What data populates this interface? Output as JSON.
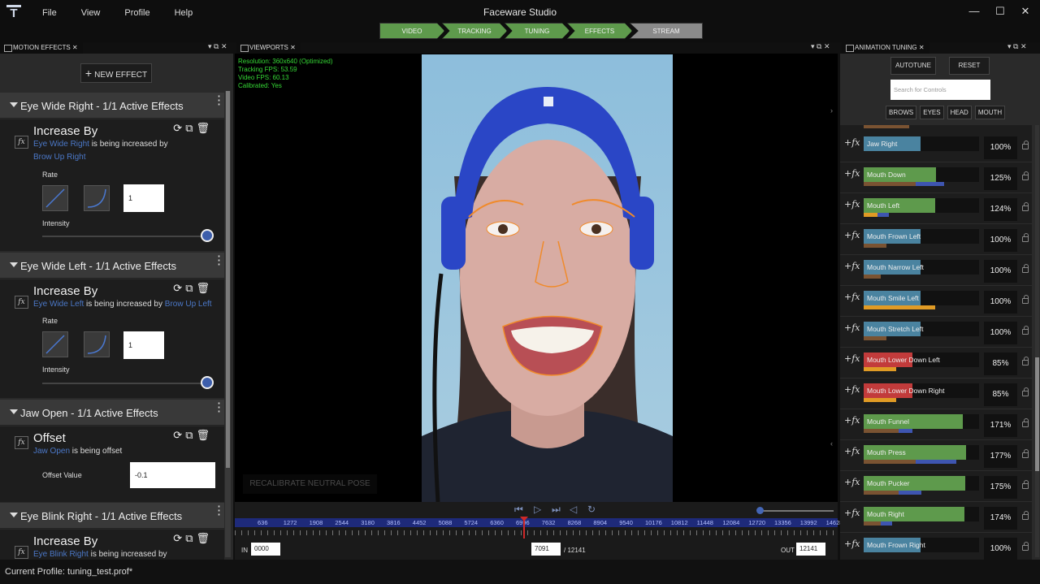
{
  "app": {
    "title": "Faceware Studio",
    "logo": "T",
    "menu": [
      "File",
      "View",
      "Profile",
      "Help"
    ],
    "window_controls": {
      "minimize": "—",
      "maximize": "☐",
      "close": "✕"
    }
  },
  "workflow": [
    "VIDEO",
    "TRACKING",
    "TUNING",
    "EFFECTS",
    "STREAM"
  ],
  "panels": {
    "motion_effects": "MOTION EFFECTS",
    "viewports": "VIEWPORTS",
    "animation_tuning": "ANIMATION TUNING",
    "close_glyph": "✕",
    "pin_glyph": "▾ ⧉ ✕"
  },
  "motion_effects": {
    "new_effect_label": "NEW EFFECT",
    "groups": [
      {
        "header": "Eye Wide Right - 1/1 Active Effects",
        "type": "Increase By",
        "target": "Eye Wide Right",
        "desc_mid": " is being increased by ",
        "source": "Brow Up Right",
        "rate_label": "Rate",
        "rate_value": "1",
        "intensity_label": "Intensity",
        "intensity": 1.0
      },
      {
        "header": "Eye Wide Left - 1/1 Active Effects",
        "type": "Increase By",
        "target": "Eye Wide Left",
        "desc_mid": " is being increased by ",
        "source": "Brow Up Left",
        "rate_label": "Rate",
        "rate_value": "1",
        "intensity_label": "Intensity",
        "intensity": 1.0
      },
      {
        "header": "Jaw Open - 1/1 Active Effects",
        "type": "Offset",
        "target": "Jaw Open",
        "desc_mid": " is being offset",
        "offset_label": "Offset Value",
        "offset_value": "-0.1"
      },
      {
        "header": "Eye Blink Right - 1/1 Active Effects",
        "type": "Increase By",
        "target": "Eye Blink Right",
        "desc_mid": " is being increased by"
      }
    ],
    "icons": {
      "fx": "fx",
      "reset": "⟳",
      "edit": "⧉",
      "delete": "🗑"
    }
  },
  "viewport": {
    "stats": [
      "Resolution: 360x640 (Optimized)",
      "Tracking FPS: 53.59",
      "Video FPS: 60.13",
      "Calibrated: Yes"
    ],
    "recalibrate_label": "RECALIBRATE NEUTRAL POSE"
  },
  "timeline": {
    "ticks": [
      "636",
      "1272",
      "1908",
      "2544",
      "3180",
      "3816",
      "4452",
      "5088",
      "5724",
      "6360",
      "6996",
      "7632",
      "8268",
      "8904",
      "9540",
      "10176",
      "10812",
      "11448",
      "12084",
      "12720",
      "13356",
      "13992",
      "14628",
      "15264",
      "15900"
    ],
    "in_label": "IN",
    "in_value": "0000",
    "current_frame": "7091",
    "total_frames": "/ 12141",
    "out_label": "OUT",
    "out_value": "12141",
    "playhead_frame": 7091,
    "transport_icons": [
      "skip-start",
      "play",
      "skip-end",
      "step-back",
      "loop"
    ]
  },
  "animation_tuning": {
    "autotune_label": "AUTOTUNE",
    "reset_label": "RESET",
    "search_placeholder": "Search for Controls",
    "filters": [
      "BROWS",
      "EYES",
      "HEAD",
      "MOUTH"
    ],
    "plus_fx": "+fx",
    "colors": {
      "green": "#5e9a4c",
      "blue": "#4a83a0",
      "red": "#c23b3b",
      "orange": "#e09b25",
      "brown": "#7a5332",
      "indigo": "#3e55b0"
    },
    "controls": [
      {
        "name": "Jaw Right",
        "pct": "100%",
        "level": 0.49,
        "color": "blue",
        "sub": [
          {
            "c": "brown",
            "w": 0.0
          }
        ]
      },
      {
        "name": "Mouth Down",
        "pct": "125%",
        "level": 0.63,
        "color": "green",
        "sub": [
          {
            "c": "brown",
            "w": 0.45
          },
          {
            "c": "indigo",
            "w": 0.25
          }
        ]
      },
      {
        "name": "Mouth Left",
        "pct": "124%",
        "level": 0.62,
        "color": "green",
        "sub": [
          {
            "c": "orange",
            "w": 0.12
          },
          {
            "c": "indigo",
            "w": 0.1
          }
        ]
      },
      {
        "name": "Mouth Frown Left",
        "pct": "100%",
        "level": 0.49,
        "color": "blue",
        "sub": [
          {
            "c": "brown",
            "w": 0.2
          }
        ]
      },
      {
        "name": "Mouth Narrow Left",
        "pct": "100%",
        "level": 0.49,
        "color": "blue",
        "sub": [
          {
            "c": "brown",
            "w": 0.15
          }
        ]
      },
      {
        "name": "Mouth Smile Left",
        "pct": "100%",
        "level": 0.49,
        "color": "blue",
        "sub": [
          {
            "c": "orange",
            "w": 0.62
          }
        ]
      },
      {
        "name": "Mouth Stretch Left",
        "pct": "100%",
        "level": 0.49,
        "color": "blue",
        "sub": [
          {
            "c": "brown",
            "w": 0.2
          }
        ]
      },
      {
        "name": "Mouth Lower Down Left",
        "pct": "85%",
        "level": 0.42,
        "color": "red",
        "sub": [
          {
            "c": "orange",
            "w": 0.28
          }
        ]
      },
      {
        "name": "Mouth Lower Down Right",
        "pct": "85%",
        "level": 0.42,
        "color": "red",
        "sub": [
          {
            "c": "orange",
            "w": 0.28
          }
        ]
      },
      {
        "name": "Mouth Funnel",
        "pct": "171%",
        "level": 0.86,
        "color": "green",
        "sub": [
          {
            "c": "brown",
            "w": 0.3
          },
          {
            "c": "indigo",
            "w": 0.12
          }
        ]
      },
      {
        "name": "Mouth Press",
        "pct": "177%",
        "level": 0.89,
        "color": "green",
        "sub": [
          {
            "c": "brown",
            "w": 0.45
          },
          {
            "c": "indigo",
            "w": 0.35
          }
        ]
      },
      {
        "name": "Mouth Pucker",
        "pct": "175%",
        "level": 0.88,
        "color": "green",
        "sub": [
          {
            "c": "brown",
            "w": 0.3
          },
          {
            "c": "indigo",
            "w": 0.2
          }
        ]
      },
      {
        "name": "Mouth Right",
        "pct": "174%",
        "level": 0.87,
        "color": "green",
        "sub": [
          {
            "c": "brown",
            "w": 0.15
          },
          {
            "c": "indigo",
            "w": 0.1
          }
        ]
      },
      {
        "name": "Mouth Frown Right",
        "pct": "100%",
        "level": 0.49,
        "color": "blue",
        "sub": []
      }
    ]
  },
  "status": {
    "profile_text": "Current Profile: tuning_test.prof*"
  }
}
